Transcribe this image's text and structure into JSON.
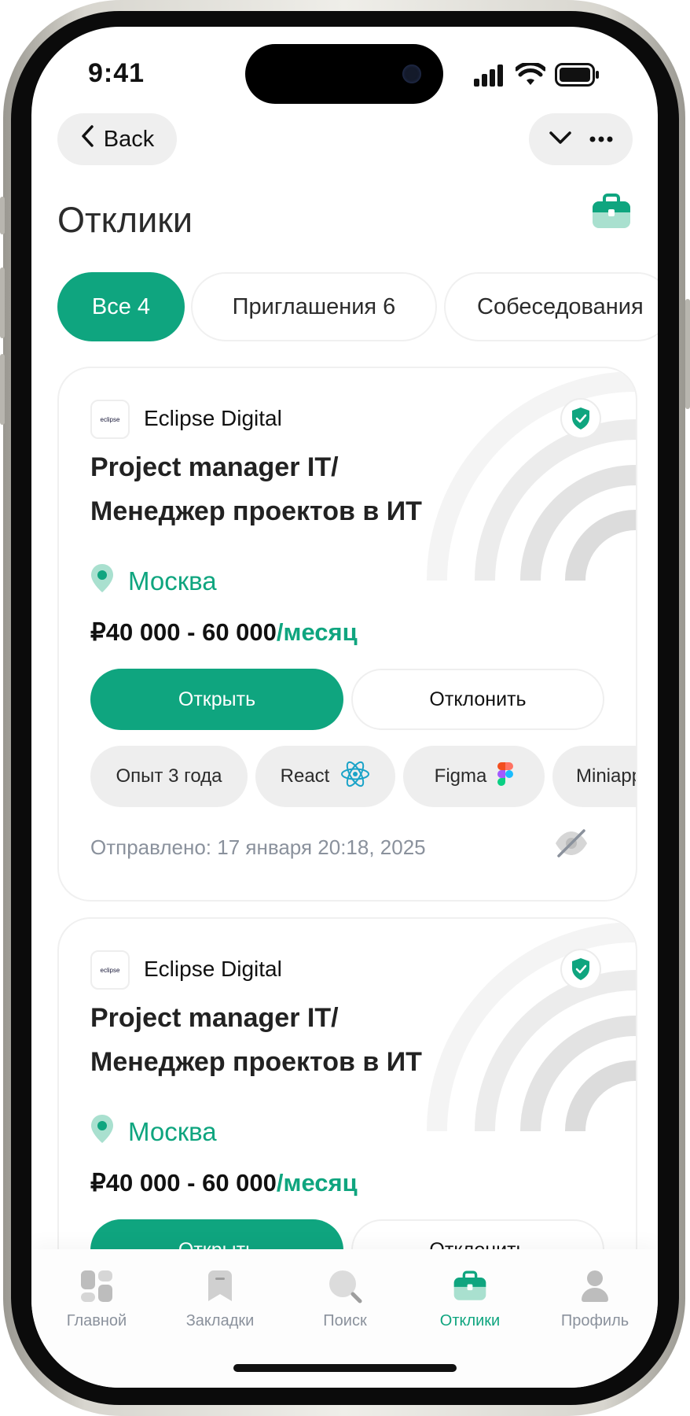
{
  "status_bar": {
    "time": "9:41"
  },
  "header": {
    "back_label": "Back",
    "title": "Отклики"
  },
  "tabs": [
    {
      "label": "Все 4",
      "active": true
    },
    {
      "label": "Приглашения 6",
      "active": false
    },
    {
      "label": "Собеседования",
      "active": false
    }
  ],
  "cards": [
    {
      "company": "Eclipse Digital",
      "logo_text": "eclipse",
      "title_line1": "Project manager IT/",
      "title_line2": "Менеджер проектов в ИТ",
      "city": "Москва",
      "salary": "₽40 000 - 60 000",
      "salary_period": "/месяц",
      "open_label": "Открыть",
      "reject_label": "Отклонить",
      "chips": [
        "Опыт 3 года",
        "React",
        "Figma",
        "Miniapp"
      ],
      "sent": "Отправлено: 17 января 20:18, 2025"
    },
    {
      "company": "Eclipse Digital",
      "logo_text": "eclipse",
      "title_line1": "Project manager IT/",
      "title_line2": "Менеджер проектов в ИТ",
      "city": "Москва",
      "salary": "₽40 000 - 60 000",
      "salary_period": "/месяц",
      "open_label": "Открыть",
      "reject_label": "Отклонить"
    }
  ],
  "tabbar": [
    {
      "label": "Главной",
      "icon": "home-grid-icon"
    },
    {
      "label": "Закладки",
      "icon": "bookmark-icon"
    },
    {
      "label": "Поиск",
      "icon": "search-icon"
    },
    {
      "label": "Отклики",
      "icon": "briefcase-icon",
      "active": true
    },
    {
      "label": "Профиль",
      "icon": "profile-icon"
    }
  ],
  "colors": {
    "accent": "#0fa57f",
    "accent_light": "#a9e0cf",
    "muted": "#8a919c",
    "chip_bg": "#eeeeee"
  }
}
